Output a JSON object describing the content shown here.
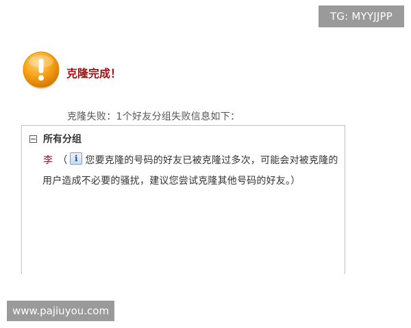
{
  "watermarks": {
    "top_right": "TG: MYYJJPP",
    "bottom_left": "www.pajiuyou.com"
  },
  "dialog": {
    "icon": "warning-exclamation-icon",
    "accent_color": "#f39800",
    "title": "克隆完成！",
    "subtitle": "克隆失败：1个好友分组失败信息如下：",
    "group": {
      "label": "所有分组",
      "entries": [
        {
          "name": "李",
          "open_paren": "（",
          "info_icon": "info-icon",
          "message": "您要克隆的号码的好友已被克隆过多次，可能会对被克隆的用户造成不必要的骚扰，建议您尝试克隆其他号码的好友。）"
        }
      ]
    }
  }
}
